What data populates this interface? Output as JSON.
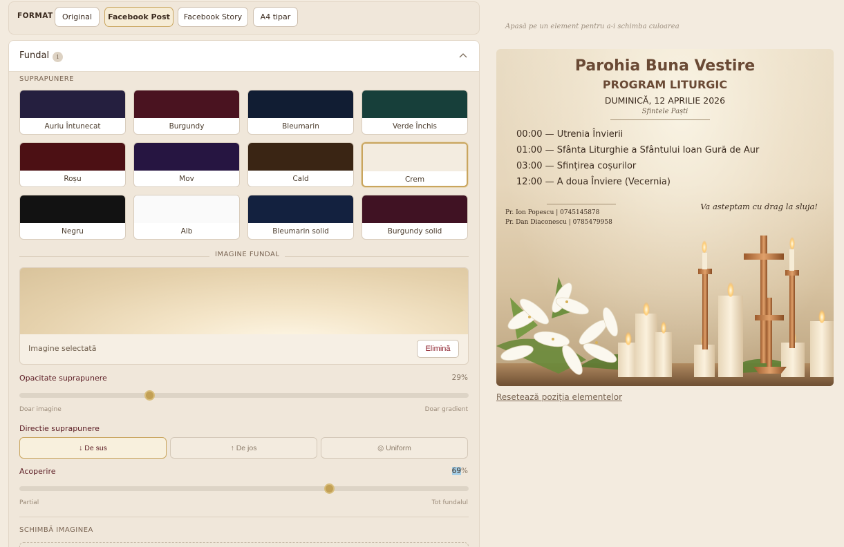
{
  "format": {
    "label": "FORMAT",
    "options": [
      "Original",
      "Facebook Post",
      "Facebook Story",
      "A4 tipar"
    ],
    "selected": "Facebook Post"
  },
  "panel": {
    "title": "Fundal",
    "info_icon": "i",
    "overlay_label": "SUPRAPUNERE",
    "swatches": [
      {
        "label": "Auriu Întunecat",
        "color": "#251f3f"
      },
      {
        "label": "Burgundy",
        "color": "#4a1320"
      },
      {
        "label": "Bleumarin",
        "color": "#111d33"
      },
      {
        "label": "Verde Închis",
        "color": "#173f3a"
      },
      {
        "label": "Roșu",
        "color": "#4c1014"
      },
      {
        "label": "Mov",
        "color": "#261541"
      },
      {
        "label": "Cald",
        "color": "#3a2514"
      },
      {
        "label": "Crem",
        "color": "#f3ece0"
      },
      {
        "label": "Negru",
        "color": "#121212"
      },
      {
        "label": "Alb",
        "color": "#fafafa"
      },
      {
        "label": "Bleumarin solid",
        "color": "#13213f"
      },
      {
        "label": "Burgundy solid",
        "color": "#401223"
      }
    ],
    "selected_swatch": "Crem",
    "image_label": "IMAGINE FUNDAL",
    "image_selected": "Imagine selectată",
    "remove_button": "Elimină",
    "opacity": {
      "label": "Opacitate suprapunere",
      "value": 29,
      "unit": "%",
      "min_label": "Doar imagine",
      "max_label": "Doar gradient"
    },
    "direction": {
      "label": "Directie suprapunere",
      "options": [
        "↓ De sus",
        "↑ De jos",
        "◎ Uniform"
      ],
      "selected": "↓ De sus"
    },
    "coverage": {
      "label": "Acoperire",
      "value": 69,
      "unit": "%",
      "min_label": "Partial",
      "max_label": "Tot fundalul"
    },
    "change_image_label": "SCHIMBĂ IMAGINEA"
  },
  "preview": {
    "hint": "Apasă pe un element pentru a-i schimba culoarea",
    "title": "Parohia Buna Vestire",
    "subtitle": "PROGRAM LITURGIC",
    "date": "DUMINICĂ, 12 APRILIE 2026",
    "feast": "Sfintele Paști",
    "schedule": [
      "00:00 — Utrenia Învierii",
      "01:00 — Sfânta Liturghie a Sfântului Ioan Gură de Aur",
      "03:00 — Sfințirea coșurilor",
      "12:00 — A doua Înviere (Vecernia)"
    ],
    "invite": "Va asteptam cu drag la sluja!",
    "contacts": [
      "Pr. Ion Popescu  |  0745145878",
      "Pr. Dan Diaconescu  |  0785479958"
    ],
    "reset_link": "Resetează poziția elementelor"
  },
  "colors": {
    "accent": "#c9a55e",
    "burgundy": "#8b1e2a",
    "title_brown": "#6a4a35"
  }
}
